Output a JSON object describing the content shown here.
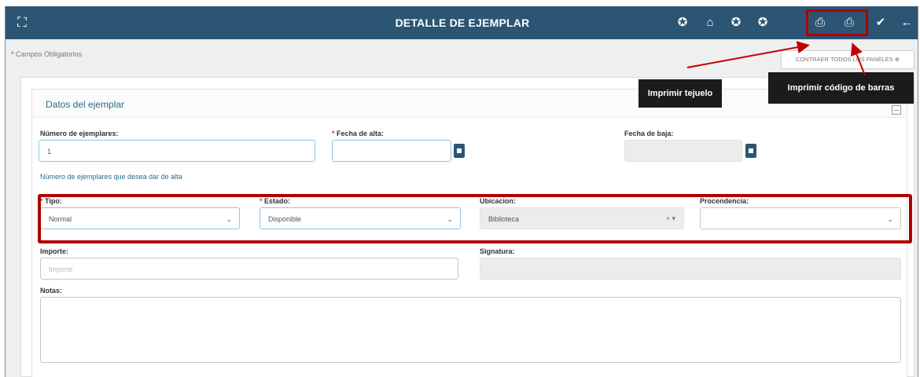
{
  "header": {
    "title": "DETALLE DE EJEMPLAR",
    "expand_icon": "fullscreen-icon",
    "buttons": [
      {
        "name": "book-icon-1",
        "glyph": "✪"
      },
      {
        "name": "home-icon",
        "glyph": "⌂"
      },
      {
        "name": "book-icon-2",
        "glyph": "✪"
      },
      {
        "name": "book-icon-3",
        "glyph": "✪"
      },
      {
        "name": "print-tejuelo-icon",
        "glyph": "⎙"
      },
      {
        "name": "print-barcode-icon",
        "glyph": "⎙"
      },
      {
        "name": "check-icon",
        "glyph": "✔"
      },
      {
        "name": "back-arrow-icon",
        "glyph": "←"
      }
    ]
  },
  "required_note": {
    "star": "*",
    "text": "Campos Obligatorios"
  },
  "collapse_button": {
    "label": "CONTRAER TODOS LOS PANELES ⊕"
  },
  "tooltips": {
    "tejuelo": "Imprimir tejuelo",
    "barcode": "Imprimir código de barras"
  },
  "panel": {
    "title": "Datos del ejemplar",
    "fields": {
      "numero_ejemplares": {
        "label": "Número de ejemplares:",
        "value": "1",
        "help": "Número de ejemplares que desea dar de alta"
      },
      "fecha_alta": {
        "star": "*",
        "label": "Fecha de alta:",
        "value": ""
      },
      "fecha_baja": {
        "label": "Fecha de baja:",
        "value": ""
      },
      "tipo": {
        "star": "*",
        "label": "Tipo:",
        "value": "Normal"
      },
      "estado": {
        "star": "*",
        "label": "Estado:",
        "value": "Disponible"
      },
      "ubicacion": {
        "label": "Ubicacion:",
        "value": "Biblioteca",
        "clear": "×"
      },
      "procedencia": {
        "label": "Procendencia:",
        "value": ""
      },
      "importe": {
        "label": "Importe:",
        "placeholder": "Importe"
      },
      "signatura": {
        "label": "Signatura:",
        "value": ""
      },
      "notas": {
        "label": "Notas:",
        "value": ""
      }
    }
  },
  "colors": {
    "header_bg": "#2c5573",
    "highlight": "#b00000",
    "required_star": "#d9302c"
  }
}
